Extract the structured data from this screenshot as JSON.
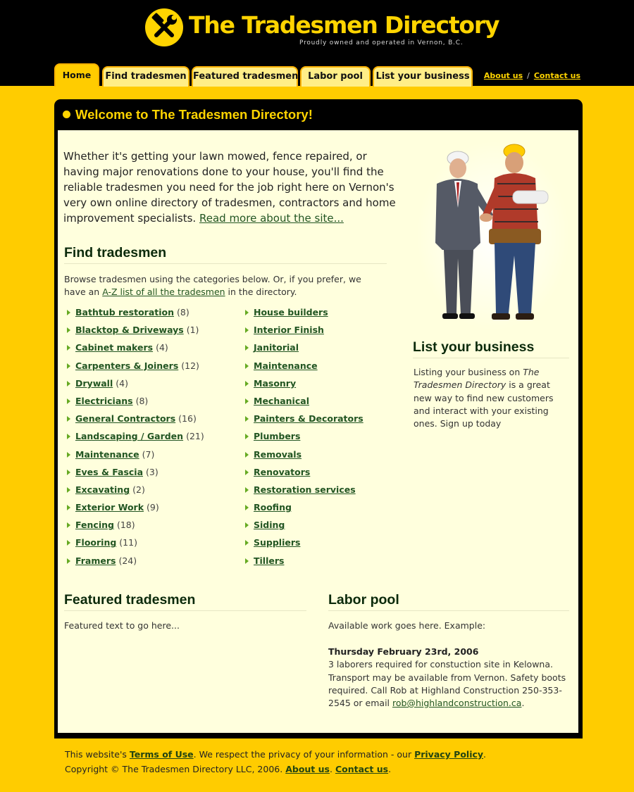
{
  "header": {
    "title": "The Tradesmen Directory",
    "tagline": "Proudly owned and operated in Vernon, B.C.",
    "logo_icon": "hammer-wrench-icon"
  },
  "tabs": [
    {
      "label": "Home",
      "active": true
    },
    {
      "label": "Find tradesmen",
      "active": false
    },
    {
      "label": "Featured tradesmen",
      "active": false
    },
    {
      "label": "Labor pool",
      "active": false
    },
    {
      "label": "List your business",
      "active": false
    }
  ],
  "toplinks": {
    "about": "About us",
    "separator": "/",
    "contact": "Contact us"
  },
  "welcome": {
    "title": "Welcome to The Tradesmen Directory!"
  },
  "intro": {
    "text": "Whether it's getting your lawn mowed, fence repaired, or having major renovations done to your house, you'll find the reliable tradesmen you need for the job right here on Vernon's very own online directory of tradesmen, contractors and home improvement specialists. ",
    "link": "Read more about the site..."
  },
  "find": {
    "heading": "Find tradesmen",
    "desc_before": "Browse tradesmen using the categories below. Or, if you prefer, we have an ",
    "desc_link": "A-Z list of all the tradesmen",
    "desc_after": " in the directory.",
    "col1": [
      {
        "name": "Bathtub restoration",
        "count": "(8)"
      },
      {
        "name": "Blacktop & Driveways",
        "count": "(1)"
      },
      {
        "name": "Cabinet makers",
        "count": "(4)"
      },
      {
        "name": "Carpenters & Joiners",
        "count": "(12)"
      },
      {
        "name": "Drywall",
        "count": "(4)"
      },
      {
        "name": "Electricians",
        "count": "(8)"
      },
      {
        "name": "General Contractors",
        "count": "(16)"
      },
      {
        "name": "Landscaping / Garden",
        "count": "(21)"
      },
      {
        "name": "Maintenance",
        "count": "(7)"
      },
      {
        "name": "Eves & Fascia",
        "count": "(3)"
      },
      {
        "name": "Excavating",
        "count": "(2)"
      },
      {
        "name": "Exterior Work",
        "count": "(9)"
      },
      {
        "name": "Fencing",
        "count": "(18)"
      },
      {
        "name": "Flooring",
        "count": "(11)"
      },
      {
        "name": "Framers",
        "count": "(24)"
      }
    ],
    "col2": [
      {
        "name": "House builders"
      },
      {
        "name": "Interior Finish"
      },
      {
        "name": "Janitorial"
      },
      {
        "name": "Maintenance "
      },
      {
        "name": "Masonry"
      },
      {
        "name": "Mechanical "
      },
      {
        "name": "Painters & Decorators"
      },
      {
        "name": "Plumbers"
      },
      {
        "name": "Removals"
      },
      {
        "name": "Renovators "
      },
      {
        "name": "Restoration services "
      },
      {
        "name": "Roofing"
      },
      {
        "name": "Siding"
      },
      {
        "name": "Suppliers"
      },
      {
        "name": "Tillers"
      }
    ]
  },
  "listbiz": {
    "heading": "List your business",
    "before": "Listing your business on ",
    "em": "The Tradesmen Directory",
    "after": " is a great new way to find new customers and interact with your existing ones. Sign up today"
  },
  "featured": {
    "heading": "Featured tradesmen",
    "text": "Featured text to go here..."
  },
  "labor": {
    "heading": "Labor pool",
    "intro": "Available work goes here. Example:",
    "date": "Thursday February 23rd, 2006",
    "body": "3 laborers required for constuction site in Kelowna. Transport may be available from Vernon. Safety boots required. Call Rob at Highland Construction 250-353-2545 or email ",
    "email": "rob@highlandconstruction.ca",
    "end": "."
  },
  "footer": {
    "l1_a": "This website's ",
    "terms": "Terms of Use",
    "l1_b": ". We respect the privacy of your information - our ",
    "privacy": "Privacy Policy",
    "l1_c": ".",
    "l2_a": "Copyright © The Tradesmen Directory LLC, 2006. ",
    "about": "About us",
    "l2_b": ". ",
    "contact": "Contact us",
    "l2_c": "."
  },
  "colors": {
    "brand_yellow": "#ffcc00",
    "header_black": "#000000",
    "content_bg": "#ffffdd",
    "link_green": "#225522"
  }
}
